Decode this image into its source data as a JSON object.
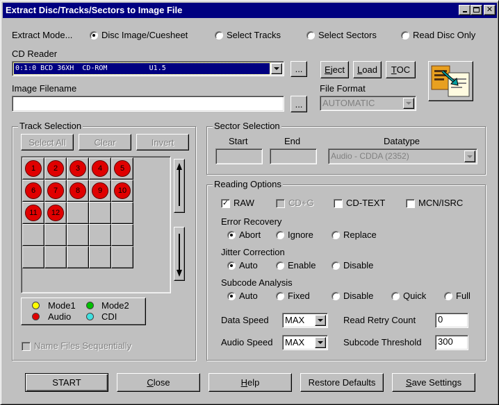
{
  "window": {
    "title": "Extract Disc/Tracks/Sectors to Image File"
  },
  "extract_mode": {
    "label": "Extract Mode...",
    "options": [
      "Disc Image/Cuesheet",
      "Select Tracks",
      "Select Sectors",
      "Read Disc Only"
    ],
    "selected": "Disc Image/Cuesheet"
  },
  "cd_reader": {
    "label": "CD Reader",
    "value": "0:1:0 BCD 36XH  CD-ROM          U1.5",
    "browse": "...",
    "eject": "Eject",
    "load": "Load",
    "toc": "TOC"
  },
  "image_filename": {
    "label": "Image Filename",
    "value": "",
    "browse": "..."
  },
  "file_format": {
    "label": "File Format",
    "value": "AUTOMATIC"
  },
  "track_selection": {
    "title": "Track Selection",
    "select_all": "Select All",
    "clear": "Clear",
    "invert": "Invert",
    "tracks": [
      "1",
      "2",
      "3",
      "4",
      "5",
      "6",
      "7",
      "8",
      "9",
      "10",
      "11",
      "12"
    ],
    "legend": {
      "mode1": "Mode1",
      "mode2": "Mode2",
      "audio": "Audio",
      "cdi": "CDI"
    },
    "name_files": "Name Files Sequentially"
  },
  "sector_selection": {
    "title": "Sector Selection",
    "start_label": "Start",
    "end_label": "End",
    "datatype_label": "Datatype",
    "start_value": "",
    "end_value": "",
    "datatype_value": "Audio - CDDA (2352)"
  },
  "reading_options": {
    "title": "Reading Options",
    "raw": "RAW",
    "cdg": "CD+G",
    "cdtext": "CD-TEXT",
    "mcn": "MCN/ISRC",
    "error_recovery": {
      "label": "Error Recovery",
      "options": [
        "Abort",
        "Ignore",
        "Replace"
      ],
      "selected": "Abort"
    },
    "jitter_correction": {
      "label": "Jitter Correction",
      "options": [
        "Auto",
        "Enable",
        "Disable"
      ],
      "selected": "Auto"
    },
    "subcode_analysis": {
      "label": "Subcode Analysis",
      "options": [
        "Auto",
        "Fixed",
        "Disable",
        "Quick",
        "Full"
      ],
      "selected": "Auto"
    },
    "data_speed_label": "Data Speed",
    "data_speed_value": "MAX",
    "audio_speed_label": "Audio Speed",
    "audio_speed_value": "MAX",
    "retry_label": "Read Retry Count",
    "retry_value": "0",
    "threshold_label": "Subcode Threshold",
    "threshold_value": "300"
  },
  "buttons": {
    "start": "START",
    "close": "Close",
    "help": "Help",
    "restore": "Restore Defaults",
    "save": "Save Settings"
  },
  "colors": {
    "titlebar": "#000080",
    "audio": "#e00000",
    "mode1": "#ffff00",
    "mode2": "#00c000",
    "cdi": "#40e0e0"
  }
}
